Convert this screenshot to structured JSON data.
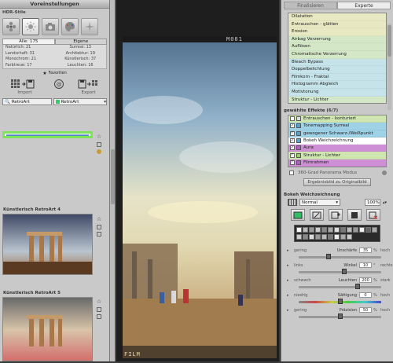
{
  "left": {
    "header": "Voreinstellungen",
    "section_title": "HDR-Stile",
    "style_icons": [
      "fan-icon",
      "sun-icon",
      "camera-icon",
      "palette-icon",
      "star-icon"
    ],
    "filter_tabs": [
      "Alle: 175",
      "Eigene"
    ],
    "counts": [
      "Natürlich: 21",
      "Surreal: 13",
      "Landschaft: 31",
      "Architektur: 19",
      "Monochrom: 21",
      "Künstlerisch: 37",
      "Farbtreue: 17",
      "Leuchten: 16"
    ],
    "favorites_label": "Favoriten",
    "import_label": "Import",
    "export_label": "Export",
    "search_text": "RetroArt",
    "filter_value": "RetroArt",
    "presets": [
      {
        "title": ""
      },
      {
        "title": "Künstlerisch RetroArt 4"
      },
      {
        "title": "Künstlerisch RetroArt 5"
      }
    ]
  },
  "center": {
    "film_top": "M081",
    "film_bottom": "FILM"
  },
  "right": {
    "tabs": [
      "Finalisieren",
      "Experte"
    ],
    "effects": [
      "Dilatation",
      "Entrauschen - glätten",
      "Erosion",
      "Airbag Verzerrung",
      "Auflösen",
      "Chromatische Verzerrung",
      "Bleach Bypass",
      "Doppelbelichtung",
      "Filmkorn - Fraktal",
      "Histogramm Abgleich",
      "Motivtonung",
      "Struktur - Lichter"
    ],
    "selected_header": "gewählte Effekte (6/7)",
    "selected": [
      {
        "label": "Entrauschen - konturiert",
        "checked": false,
        "color": "#cfe6b0"
      },
      {
        "label": "Tonemapping Surreal",
        "checked": true,
        "color": "#9fd2e6"
      },
      {
        "label": "gewogener Schwarz-/Weißpunkt",
        "checked": true,
        "color": "#9fd2e6"
      },
      {
        "label": "Bokeh Weichzeichnung",
        "checked": true,
        "color": "#ffffff"
      },
      {
        "label": "Aura",
        "checked": true,
        "color": "#cf8fd6"
      },
      {
        "label": "Struktur - Lichter",
        "checked": true,
        "color": "#cfe6b0"
      },
      {
        "label": "Filmrahmen",
        "checked": true,
        "color": "#cf8fd6"
      }
    ],
    "pano_label": "360-Grad Panorama Modus",
    "apply_button": "Ergebnisbild zu Originalbild",
    "bokeh_header": "Bokeh Weichzeichnung",
    "blend_mode": "Normal",
    "opacity": "100%",
    "sliders": [
      {
        "name": "Unschärfe",
        "low": "gering",
        "high": "hoch",
        "value": "35",
        "unit": "%",
        "fraction": 0.35
      },
      {
        "name": "Winkel",
        "low": "links",
        "high": "rechts",
        "value": "10",
        "unit": "°",
        "fraction": 0.55
      },
      {
        "name": "Leuchten",
        "low": "schwach",
        "high": "stark",
        "value": "200",
        "unit": "%",
        "fraction": 0.72
      },
      {
        "name": "Sättigung",
        "low": "niedrig",
        "high": "hoch",
        "value": "0",
        "unit": "%",
        "fraction": 0.5
      },
      {
        "name": "Präzision",
        "low": "gering",
        "high": "hoch",
        "value": "50",
        "unit": "%",
        "fraction": 0.5
      }
    ]
  }
}
